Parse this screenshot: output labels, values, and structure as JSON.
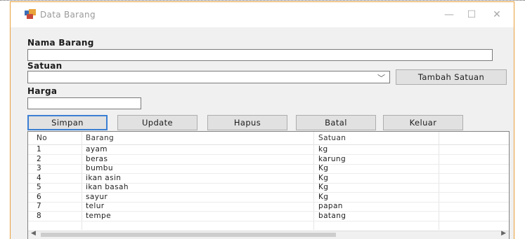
{
  "window": {
    "title": "Data Barang",
    "minimize": "—",
    "maximize": "☐",
    "close": "✕"
  },
  "form": {
    "nama_barang_label": "Nama Barang",
    "nama_barang_value": "",
    "satuan_label": "Satuan",
    "satuan_value": "",
    "tambah_satuan_label": "Tambah Satuan",
    "harga_label": "Harga",
    "harga_value": ""
  },
  "actions": {
    "simpan": "Simpan",
    "update": "Update",
    "hapus": "Hapus",
    "batal": "Batal",
    "keluar": "Keluar"
  },
  "grid": {
    "headers": {
      "no": "No",
      "barang": "Barang",
      "satuan": "Satuan"
    },
    "rows": [
      {
        "no": "1",
        "barang": "ayam",
        "satuan": "kg"
      },
      {
        "no": "2",
        "barang": "beras",
        "satuan": "karung"
      },
      {
        "no": "3",
        "barang": "bumbu",
        "satuan": "Kg"
      },
      {
        "no": "4",
        "barang": "ikan asin",
        "satuan": "Kg"
      },
      {
        "no": "5",
        "barang": "ikan basah",
        "satuan": "Kg"
      },
      {
        "no": "6",
        "barang": "sayur",
        "satuan": "Kg"
      },
      {
        "no": "7",
        "barang": "telur",
        "satuan": "papan"
      },
      {
        "no": "8",
        "barang": "tempe",
        "satuan": "batang"
      }
    ]
  },
  "colors": {
    "window_border": "#e8a03c",
    "focus_border": "#3c7fd4"
  }
}
